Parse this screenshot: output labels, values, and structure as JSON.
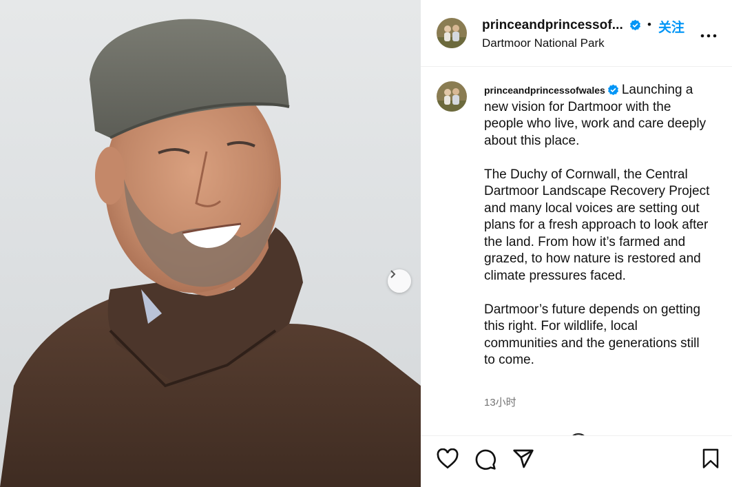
{
  "post": {
    "username": "princeandprincessof...",
    "username_full": "princeandprincessofwales",
    "follow_label": "关注",
    "separator": "•",
    "location": "Dartmoor National Park",
    "caption_lead": "Launching a new vision for Dartmoor with the people who live, work and care deeply about this place.",
    "caption_paragraphs": [
      "The Duchy of Cornwall, the Central Dartmoor Landscape Recovery Project and many local voices are setting out plans for a fresh approach to look after the land. From how it’s farmed and grazed, to how nature is restored and climate pressures faced.",
      "Dartmoor’s future depends on getting this right. For wildlife, local communities and the generations still to come."
    ],
    "timestamp": "13小时"
  },
  "icons": {
    "verified": "verified-badge-icon",
    "more": "more-options-icon",
    "next": "chevron-right-icon",
    "like": "heart-icon",
    "comment": "comment-icon",
    "share": "paper-plane-icon",
    "save": "bookmark-icon"
  },
  "colors": {
    "accent": "#0095f6",
    "text": "#111111",
    "secondary_text": "#737373",
    "divider": "#efefef"
  }
}
